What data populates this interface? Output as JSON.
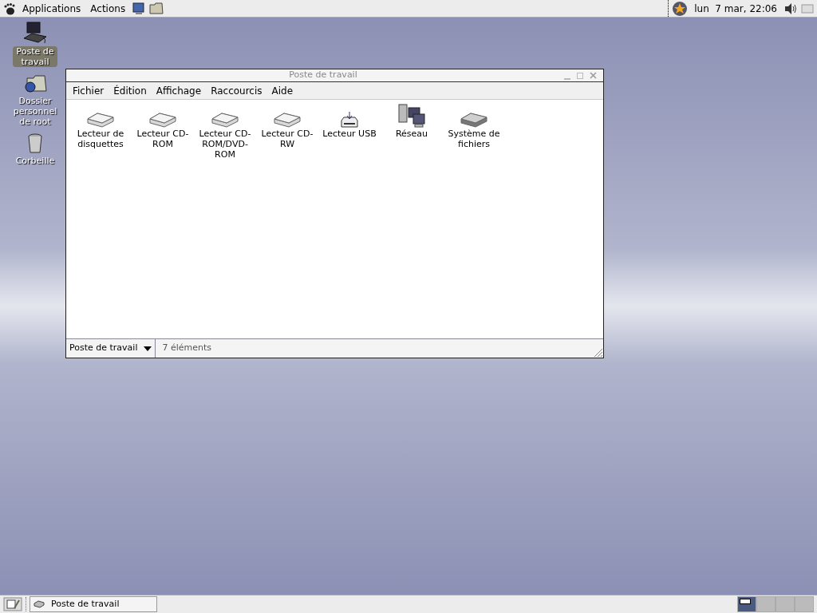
{
  "top_panel": {
    "menus": [
      "Applications",
      "Actions"
    ],
    "clock": "lun  7 mar, 22:06"
  },
  "desktop_icons": [
    {
      "label": "Poste de travail",
      "kind": "computer",
      "selected": true
    },
    {
      "label": "Dossier personnel de root",
      "kind": "home",
      "selected": false
    },
    {
      "label": "Corbeille",
      "kind": "trash",
      "selected": false
    }
  ],
  "window": {
    "title": "Poste de travail",
    "menu": [
      "Fichier",
      "Édition",
      "Affichage",
      "Raccourcis",
      "Aide"
    ],
    "items": [
      {
        "label": "Lecteur de disquettes",
        "kind": "drive"
      },
      {
        "label": "Lecteur CD-ROM",
        "kind": "drive"
      },
      {
        "label": "Lecteur CD-ROM/DVD-ROM",
        "kind": "drive"
      },
      {
        "label": "Lecteur CD-RW",
        "kind": "drive"
      },
      {
        "label": "Lecteur USB",
        "kind": "usb"
      },
      {
        "label": "Réseau",
        "kind": "network"
      },
      {
        "label": "Système de fichiers",
        "kind": "disk"
      }
    ],
    "location": "Poste de travail",
    "status": "7 éléments"
  },
  "bottom_panel": {
    "tasks": [
      {
        "label": "Poste de travail"
      }
    ],
    "workspaces": [
      {
        "selected": true
      },
      {
        "selected": false
      },
      {
        "selected": false
      },
      {
        "selected": false
      }
    ]
  }
}
